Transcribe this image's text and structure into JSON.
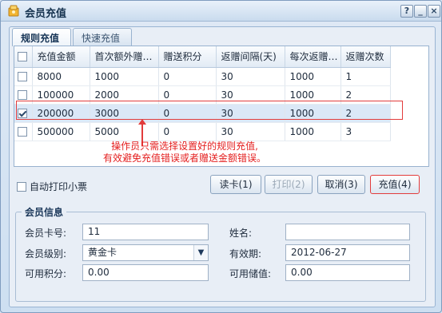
{
  "window": {
    "title": "会员充值",
    "help_label": "?",
    "minimize_label": "_",
    "close_label": "×"
  },
  "tabs": [
    {
      "label": "规则充值"
    },
    {
      "label": "快速充值"
    }
  ],
  "grid": {
    "columns": [
      "充值金额",
      "首次额外赠…",
      "赠送积分",
      "返赠间隔(天)",
      "每次返赠…",
      "返赠次数"
    ],
    "rows": [
      {
        "checked": false,
        "cells": [
          "8000",
          "1000",
          "0",
          "30",
          "1000",
          "1"
        ]
      },
      {
        "checked": false,
        "cells": [
          "100000",
          "2000",
          "0",
          "30",
          "1000",
          "2"
        ]
      },
      {
        "checked": true,
        "cells": [
          "200000",
          "3000",
          "0",
          "30",
          "1000",
          "2"
        ]
      },
      {
        "checked": false,
        "cells": [
          "500000",
          "5000",
          "0",
          "30",
          "1000",
          "3"
        ]
      }
    ]
  },
  "annotation": {
    "line1": "操作员只需选择设置好的规则充值,",
    "line2": "有效避免充值错误或者赠送金额错误。"
  },
  "options": {
    "auto_print_label": "自动打印小票",
    "auto_print_checked": false
  },
  "buttons": {
    "read_card": "读卡(1)",
    "print": "打印(2)",
    "cancel": "取消(3)",
    "recharge": "充值(4)"
  },
  "member": {
    "section_title": "会员信息",
    "card_no_label": "会员卡号:",
    "card_no_value": "11",
    "name_label": "姓名:",
    "name_value": "",
    "level_label": "会员级别:",
    "level_value": "黄金卡",
    "expiry_label": "有效期:",
    "expiry_value": "2012-06-27",
    "points_label": "可用积分:",
    "points_value": "0.00",
    "balance_label": "可用储值:",
    "balance_value": "0.00"
  },
  "colors": {
    "accent_red": "#e23c3c",
    "title_blue": "#15324f",
    "selected_row": "#dbe8f7"
  }
}
